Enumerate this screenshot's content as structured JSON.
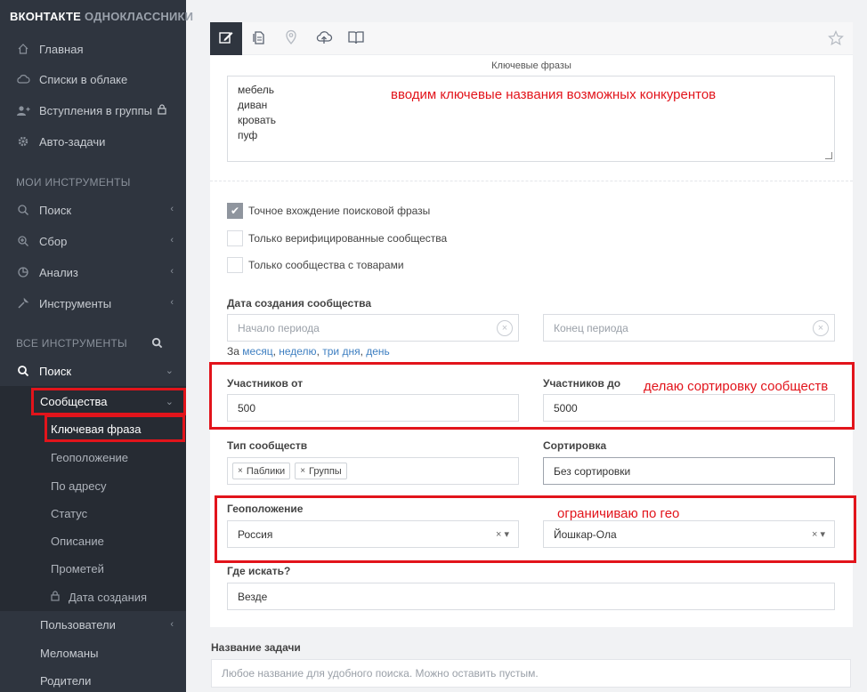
{
  "sidebar": {
    "brand_primary": "ВКОНТАКТЕ",
    "brand_secondary": "ОДНОКЛАССНИКИ",
    "top_items": [
      {
        "label": "Главная",
        "icon": "home-icon"
      },
      {
        "label": "Списки в облаке",
        "icon": "cloud-icon"
      },
      {
        "label": "Вступления в группы",
        "icon": "users-icon"
      },
      {
        "label": "Авто-задачи",
        "icon": "gear-icon"
      }
    ],
    "my_tools_label": "МОИ ИНСТРУМЕНТЫ",
    "my_tools": [
      {
        "label": "Поиск",
        "icon": "search-icon"
      },
      {
        "label": "Сбор",
        "icon": "zoom-plus-icon"
      },
      {
        "label": "Анализ",
        "icon": "pie-chart-icon"
      },
      {
        "label": "Инструменты",
        "icon": "wrench-icon"
      }
    ],
    "all_tools_label": "ВСЕ ИНСТРУМЕНТЫ",
    "search_label": "Поиск",
    "communities_label": "Сообщества",
    "sub_items": [
      "Ключевая фраза",
      "Геоположение",
      "По адресу",
      "Статус",
      "Описание",
      "Прометей",
      "Дата создания"
    ],
    "users_label": "Пользователи",
    "music_label": "Меломаны",
    "parents_label": "Родители"
  },
  "form": {
    "keywords_caption": "Ключевые фразы",
    "keywords": [
      "мебель",
      "диван",
      "кровать",
      "пуф"
    ],
    "annotation_keywords": "вводим ключевые названия возможных конкурентов",
    "checkboxes": [
      {
        "label": "Точное вхождение поисковой фразы",
        "checked": true
      },
      {
        "label": "Только верифицированные сообщества",
        "checked": false
      },
      {
        "label": "Только сообщества с товарами",
        "checked": false
      }
    ],
    "date_label": "Дата создания сообщества",
    "date_start_placeholder": "Начало периода",
    "date_end_placeholder": "Конец периода",
    "period_prefix": "За",
    "period_links": [
      "месяц",
      "неделю",
      "три дня",
      "день"
    ],
    "members_from_label": "Участников от",
    "members_from_value": "500",
    "members_to_label": "Участников до",
    "members_to_value": "5000",
    "annotation_members": "делаю сортировку сообществ",
    "type_label": "Тип сообществ",
    "type_tags": [
      "Паблики",
      "Группы"
    ],
    "sort_label": "Сортировка",
    "sort_value": "Без сортировки",
    "geo_label": "Геоположение",
    "geo_country": "Россия",
    "geo_city": "Йошкар-Ола",
    "annotation_geo": "ограничиваю по гео",
    "where_label": "Где искать?",
    "where_value": "Везде",
    "task_name_label": "Название задачи",
    "task_name_placeholder": "Любое название для удобного поиска. Можно оставить пустым."
  },
  "colors": {
    "sidebar_bg": "#2f353f",
    "accent_red": "#e2141b",
    "link_blue": "#3e7fc1"
  }
}
